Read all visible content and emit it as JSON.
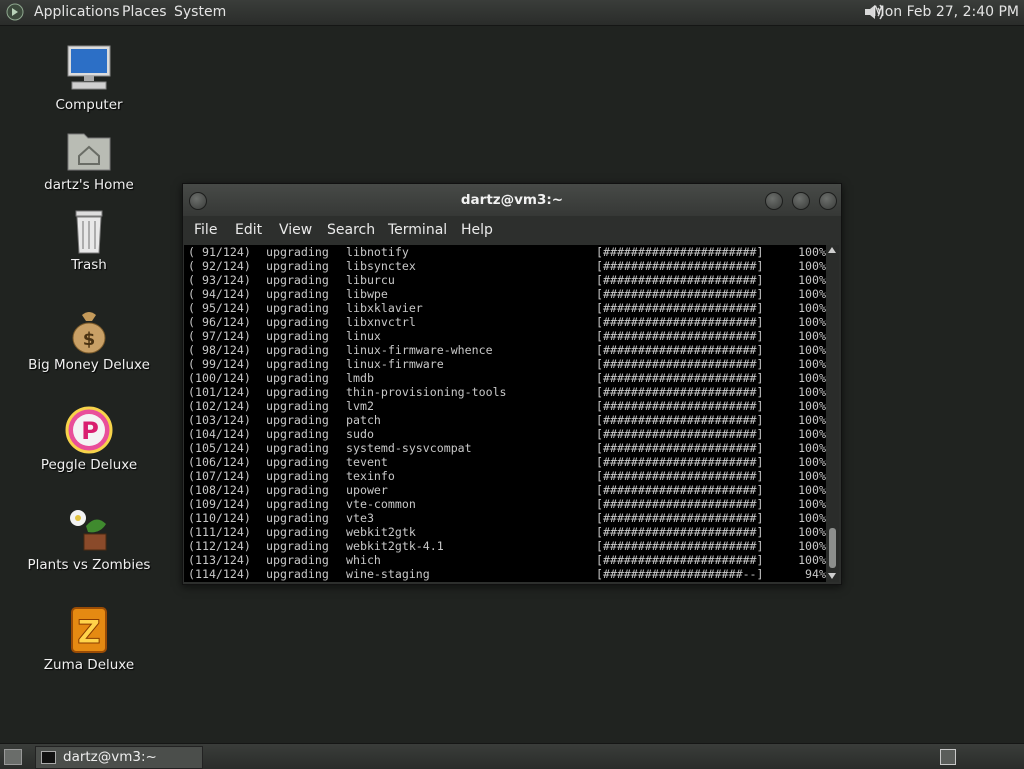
{
  "top_panel": {
    "menus": [
      "Applications",
      "Places",
      "System"
    ],
    "clock": "Mon Feb 27,  2:40 PM",
    "icons": {
      "logo": "gnome-foot-icon",
      "volume": "speaker-icon"
    }
  },
  "desktop": {
    "icons": [
      {
        "label": "Computer",
        "icon": "computer-icon"
      },
      {
        "label": "dartz's Home",
        "icon": "home-folder-icon"
      },
      {
        "label": "Trash",
        "icon": "trash-icon"
      },
      {
        "label": "Big Money Deluxe",
        "icon": "money-bag-icon"
      },
      {
        "label": "Peggle Deluxe",
        "icon": "peggle-icon"
      },
      {
        "label": "Plants vs Zombies",
        "icon": "plants-icon"
      },
      {
        "label": "Zuma Deluxe",
        "icon": "zuma-icon"
      }
    ]
  },
  "window": {
    "title": "dartz@vm3:~",
    "menu": [
      "File",
      "Edit",
      "View",
      "Search",
      "Terminal",
      "Help"
    ],
    "rows": [
      {
        "idx": "( 91/124)",
        "action": "upgrading",
        "pkg": "libnotify",
        "bar": "[######################]",
        "pct": "100%"
      },
      {
        "idx": "( 92/124)",
        "action": "upgrading",
        "pkg": "libsynctex",
        "bar": "[######################]",
        "pct": "100%"
      },
      {
        "idx": "( 93/124)",
        "action": "upgrading",
        "pkg": "liburcu",
        "bar": "[######################]",
        "pct": "100%"
      },
      {
        "idx": "( 94/124)",
        "action": "upgrading",
        "pkg": "libwpe",
        "bar": "[######################]",
        "pct": "100%"
      },
      {
        "idx": "( 95/124)",
        "action": "upgrading",
        "pkg": "libxklavier",
        "bar": "[######################]",
        "pct": "100%"
      },
      {
        "idx": "( 96/124)",
        "action": "upgrading",
        "pkg": "libxnvctrl",
        "bar": "[######################]",
        "pct": "100%"
      },
      {
        "idx": "( 97/124)",
        "action": "upgrading",
        "pkg": "linux",
        "bar": "[######################]",
        "pct": "100%"
      },
      {
        "idx": "( 98/124)",
        "action": "upgrading",
        "pkg": "linux-firmware-whence",
        "bar": "[######################]",
        "pct": "100%"
      },
      {
        "idx": "( 99/124)",
        "action": "upgrading",
        "pkg": "linux-firmware",
        "bar": "[######################]",
        "pct": "100%"
      },
      {
        "idx": "(100/124)",
        "action": "upgrading",
        "pkg": "lmdb",
        "bar": "[######################]",
        "pct": "100%"
      },
      {
        "idx": "(101/124)",
        "action": "upgrading",
        "pkg": "thin-provisioning-tools",
        "bar": "[######################]",
        "pct": "100%"
      },
      {
        "idx": "(102/124)",
        "action": "upgrading",
        "pkg": "lvm2",
        "bar": "[######################]",
        "pct": "100%"
      },
      {
        "idx": "(103/124)",
        "action": "upgrading",
        "pkg": "patch",
        "bar": "[######################]",
        "pct": "100%"
      },
      {
        "idx": "(104/124)",
        "action": "upgrading",
        "pkg": "sudo",
        "bar": "[######################]",
        "pct": "100%"
      },
      {
        "idx": "(105/124)",
        "action": "upgrading",
        "pkg": "systemd-sysvcompat",
        "bar": "[######################]",
        "pct": "100%"
      },
      {
        "idx": "(106/124)",
        "action": "upgrading",
        "pkg": "tevent",
        "bar": "[######################]",
        "pct": "100%"
      },
      {
        "idx": "(107/124)",
        "action": "upgrading",
        "pkg": "texinfo",
        "bar": "[######################]",
        "pct": "100%"
      },
      {
        "idx": "(108/124)",
        "action": "upgrading",
        "pkg": "upower",
        "bar": "[######################]",
        "pct": "100%"
      },
      {
        "idx": "(109/124)",
        "action": "upgrading",
        "pkg": "vte-common",
        "bar": "[######################]",
        "pct": "100%"
      },
      {
        "idx": "(110/124)",
        "action": "upgrading",
        "pkg": "vte3",
        "bar": "[######################]",
        "pct": "100%"
      },
      {
        "idx": "(111/124)",
        "action": "upgrading",
        "pkg": "webkit2gtk",
        "bar": "[######################]",
        "pct": "100%"
      },
      {
        "idx": "(112/124)",
        "action": "upgrading",
        "pkg": "webkit2gtk-4.1",
        "bar": "[######################]",
        "pct": "100%"
      },
      {
        "idx": "(113/124)",
        "action": "upgrading",
        "pkg": "which",
        "bar": "[######################]",
        "pct": "100%"
      },
      {
        "idx": "(114/124)",
        "action": "upgrading",
        "pkg": "wine-staging",
        "bar": "[####################--]",
        "pct": "94%"
      }
    ]
  },
  "bottom_panel": {
    "task_label": "dartz@vm3:~",
    "icons": {
      "show_desktop": "show-desktop-icon",
      "task": "terminal-icon",
      "workspace": "workspace-switcher-icon"
    }
  }
}
